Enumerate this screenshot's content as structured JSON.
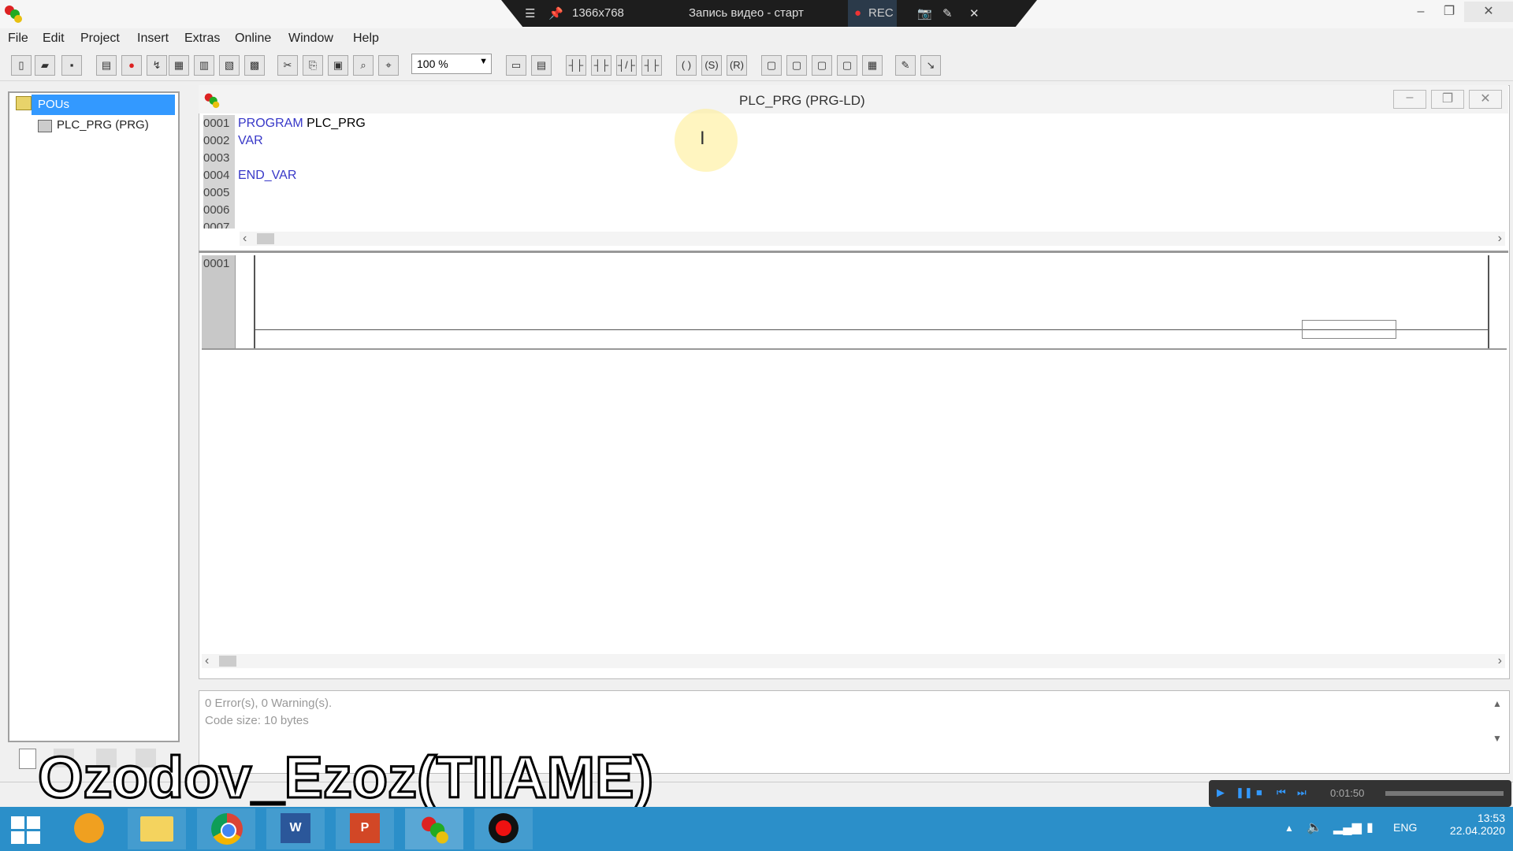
{
  "recorder": {
    "resolution": "1366x768",
    "status": "Запись видео - старт",
    "rec_label": "REC"
  },
  "menu": [
    "File",
    "Edit",
    "Project",
    "Insert",
    "Extras",
    "Online",
    "Window",
    "Help"
  ],
  "toolbar": {
    "zoom": "100 %"
  },
  "tree": {
    "root": "POUs",
    "item": "PLC_PRG (PRG)"
  },
  "editor": {
    "title": "PLC_PRG (PRG-LD)",
    "line_numbers": [
      "0001",
      "0002",
      "0003",
      "0004",
      "0005",
      "0006",
      "0007"
    ],
    "code_line1_kw": "PROGRAM",
    "code_line1_name": "PLC_PRG",
    "code_line2": "VAR",
    "code_line4": "END_VAR",
    "network_number": "0001"
  },
  "messages": {
    "line1": "0 Error(s), 0 Warning(s).",
    "line2": "Code size: 10 bytes"
  },
  "watermark": "Ozodov_Ezoz(TIIAME)",
  "player": {
    "time": "0:01:50"
  },
  "tray": {
    "lang": "ENG",
    "time": "13:53",
    "date": "22.04.2020"
  },
  "colors": {
    "selection": "#3399ff",
    "keyword": "#3838c8",
    "taskbar": "#2b8fc9"
  }
}
